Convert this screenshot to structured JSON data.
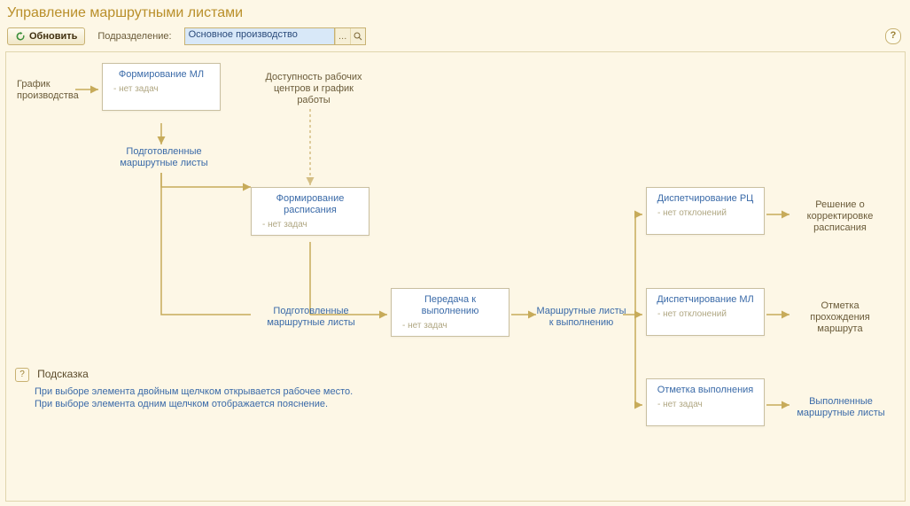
{
  "title": "Управление маршрутными листами",
  "toolbar": {
    "refresh_label": "Обновить",
    "dept_label": "Подразделение:",
    "dept_value": "Основное производство"
  },
  "nodes": {
    "form_ml": {
      "title": "Формирование МЛ",
      "status": "- нет задач"
    },
    "form_sched": {
      "title": "Формирование расписания",
      "status": "- нет задач"
    },
    "transfer": {
      "title": "Передача к выполнению",
      "status": "- нет задач"
    },
    "disp_rc": {
      "title": "Диспетчирование РЦ",
      "status": "- нет отклонений"
    },
    "disp_ml": {
      "title": "Диспетчирование МЛ",
      "status": "- нет отклонений"
    },
    "mark_done": {
      "title": "Отметка выполнения",
      "status": "- нет задач"
    }
  },
  "labels": {
    "schedule_source": "График производства",
    "availability": "Доступность рабочих центров и график работы",
    "prepared1": "Подготовленные маршрутные листы",
    "prepared2": "Подготовленные маршрутные листы",
    "routing_exec": "Маршрутные листы к выполнению",
    "decision": "Решение о корректировке расписания",
    "route_mark": "Отметка прохождения маршрута",
    "done_lists": "Выполненные маршрутные листы"
  },
  "hint": {
    "title": "Подсказка",
    "line1": "При выборе элемента двойным щелчком открывается рабочее место.",
    "line2": "При выборе элемента одним щелчком отображается пояснение."
  }
}
